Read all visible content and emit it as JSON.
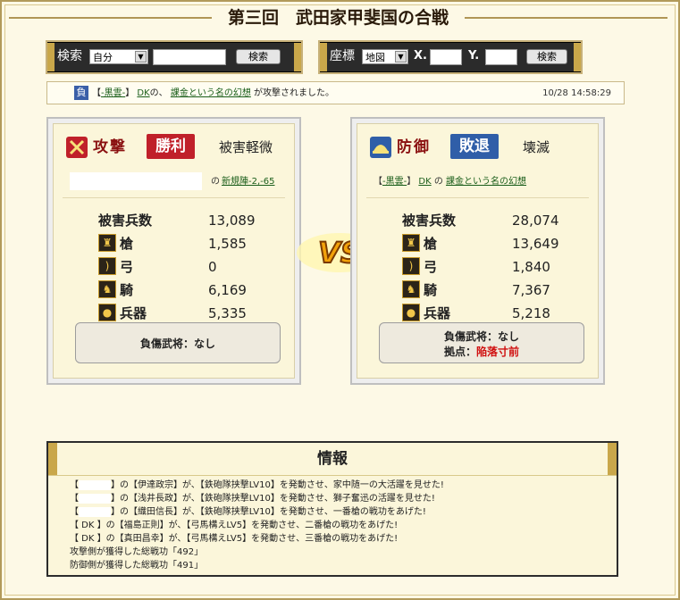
{
  "page_title": "第三回　武田家甲斐国の合戦",
  "search1": {
    "label": "検索",
    "select_value": "自分",
    "button": "検索"
  },
  "search2": {
    "label": "座標",
    "select_value": "地図",
    "x_label": "X.",
    "y_label": "Y.",
    "button": "検索"
  },
  "notice": {
    "badge": "負",
    "bracket_open": "【",
    "alliance": "-黒雲-",
    "bracket_close": "】",
    "player": "DK",
    "mid": "の、",
    "target": "課金という名の幻想",
    "suffix": "が攻撃されました。",
    "timestamp": "10/28 14:58:29"
  },
  "attack": {
    "role": "攻撃",
    "result": "勝利",
    "damage": "被害軽微",
    "of": "の",
    "location": "新規陣-2,-65",
    "total_label": "被害兵数",
    "total_value": "13,089",
    "troops": [
      {
        "label": "槍",
        "value": "1,585",
        "icon": "spear-icon"
      },
      {
        "label": "弓",
        "value": "0",
        "icon": "bow-icon"
      },
      {
        "label": "騎",
        "value": "6,169",
        "icon": "horse-icon"
      },
      {
        "label": "兵器",
        "value": "5,335",
        "icon": "siege-icon"
      }
    ],
    "wounded": "負傷武将：なし"
  },
  "defense": {
    "role": "防御",
    "result": "敗退",
    "damage": "壊滅",
    "bracket_open": "【",
    "alliance": "-黒雲-",
    "bracket_close": "】",
    "player": "DK",
    "of": "の",
    "location": "課金という名の幻想",
    "total_label": "被害兵数",
    "total_value": "28,074",
    "troops": [
      {
        "label": "槍",
        "value": "13,649",
        "icon": "spear-icon"
      },
      {
        "label": "弓",
        "value": "1,840",
        "icon": "bow-icon"
      },
      {
        "label": "騎",
        "value": "7,367",
        "icon": "horse-icon"
      },
      {
        "label": "兵器",
        "value": "5,218",
        "icon": "siege-icon"
      }
    ],
    "wounded": "負傷武将：なし",
    "base_label": "拠点：",
    "base_value": "陥落寸前"
  },
  "vs_text": "VS",
  "info": {
    "title": "情報",
    "lines": [
      {
        "pre": "【",
        "post": "】の【伊達政宗】が、【鉄砲隊挟撃LV10】を発動させ、家中随一の大活躍を見せた!"
      },
      {
        "pre": "【",
        "post": "】の【浅井長政】が、【鉄砲隊挟撃LV10】を発動させ、獅子奮迅の活躍を見せた!"
      },
      {
        "pre": "【",
        "post": "】の【織田信長】が、【鉄砲隊挟撃LV10】を発動させ、一番槍の戦功をあげた!"
      },
      {
        "pre": "【 DK 】",
        "post": "の【福島正則】が、【弓馬構えLV5】を発動させ、二番槍の戦功をあげた!"
      },
      {
        "pre": "【 DK 】",
        "post": "の【真田昌幸】が、【弓馬構えLV5】を発動させ、三番槍の戦功をあげた!"
      },
      {
        "pre": "攻撃側が獲得した総戦功「492」",
        "post": ""
      },
      {
        "pre": "防御側が獲得した総戦功「491」",
        "post": ""
      }
    ]
  },
  "colors": {
    "attack_red": "#c0202a",
    "defense_blue": "#2f5ea8",
    "accent_gold": "#c9a74a",
    "link_green": "#1a5e1a"
  }
}
